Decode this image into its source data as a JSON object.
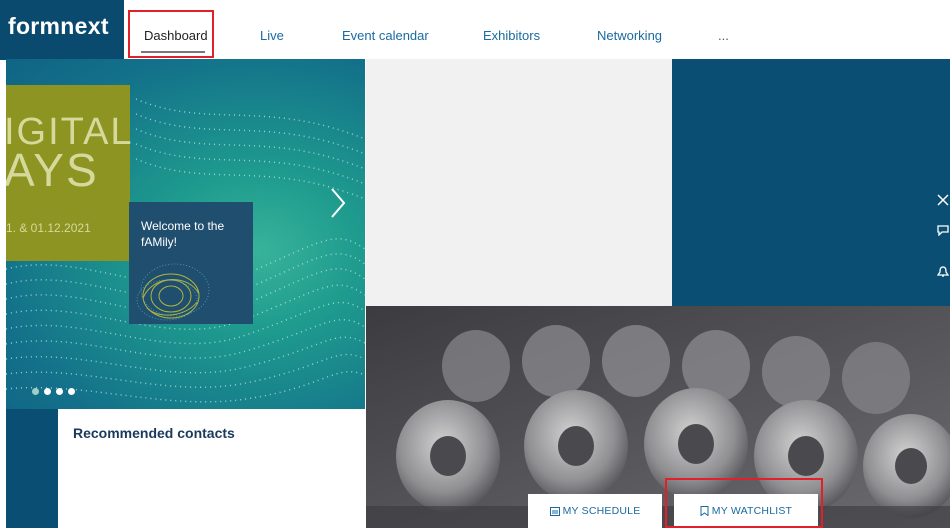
{
  "logo": {
    "text": "formnext"
  },
  "nav": {
    "items": [
      {
        "label": "Dashboard",
        "active": true
      },
      {
        "label": "Live"
      },
      {
        "label": "Event calendar"
      },
      {
        "label": "Exhibitors"
      },
      {
        "label": "Networking"
      },
      {
        "label": "..."
      }
    ]
  },
  "hero": {
    "headline_line1": "IGITAL",
    "headline_line2": "AYS",
    "date": "1. & 01.12.2021",
    "welcome": "Welcome to the fAMily!",
    "slides_count": 4,
    "active_slide": 1
  },
  "contacts": {
    "title": "Recommended contacts"
  },
  "actions": {
    "schedule_label": "MY SCHEDULE",
    "watchlist_label": "MY WATCHLIST"
  },
  "side_tabs": [
    "close-icon",
    "chat-icon",
    "bell-icon",
    "card-icon"
  ],
  "colors": {
    "brand_navy": "#0a4f73",
    "link_blue": "#1a6aa0",
    "olive": "#8d9422",
    "highlight_red": "#e0202a"
  }
}
